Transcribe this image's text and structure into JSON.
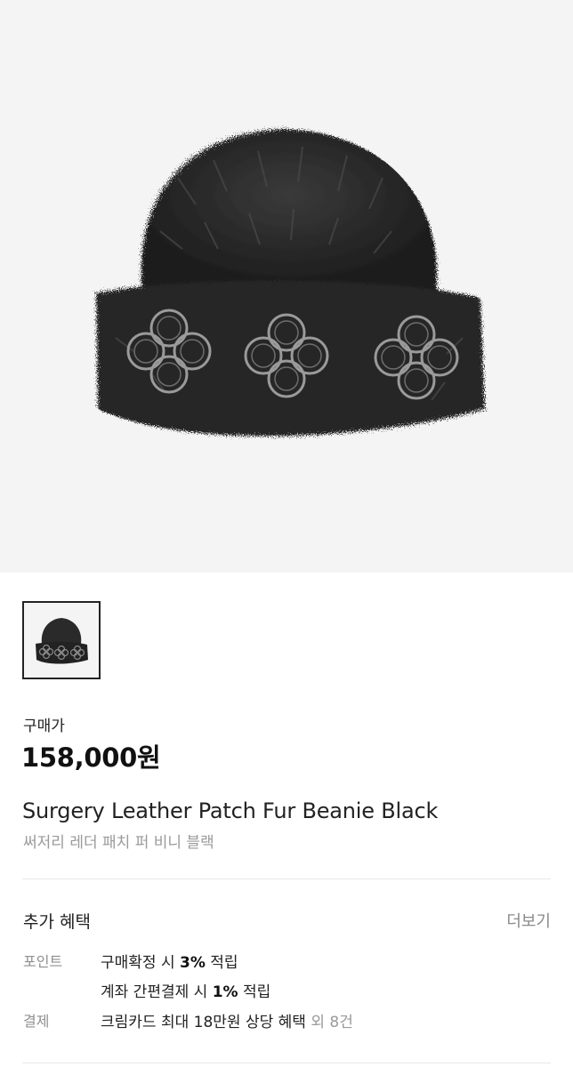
{
  "product": {
    "image_alt": "beanie-photo",
    "price_label": "구매가",
    "price": "158,000원",
    "title_en": "Surgery Leather Patch Fur Beanie Black",
    "title_ko": "써저리 레더 패치 퍼 비니 블랙"
  },
  "benefits": {
    "title": "추가 혜택",
    "more_label": "더보기",
    "rows": [
      {
        "label": "포인트",
        "pre": "구매확정 시 ",
        "bold": "3%",
        "post": " 적립",
        "extra": ""
      },
      {
        "label": "",
        "pre": "계좌 간편결제 시 ",
        "bold": "1%",
        "post": " 적립",
        "extra": ""
      },
      {
        "label": "결제",
        "pre": "크림카드 최대 18만원 상당 혜택",
        "bold": "",
        "post": "",
        "extra": " 외 8건"
      }
    ]
  },
  "colors": {
    "hero_bg": "#f4f4f4",
    "text": "#222222",
    "muted": "#9a9a9a",
    "divider": "#e8e8e8"
  }
}
